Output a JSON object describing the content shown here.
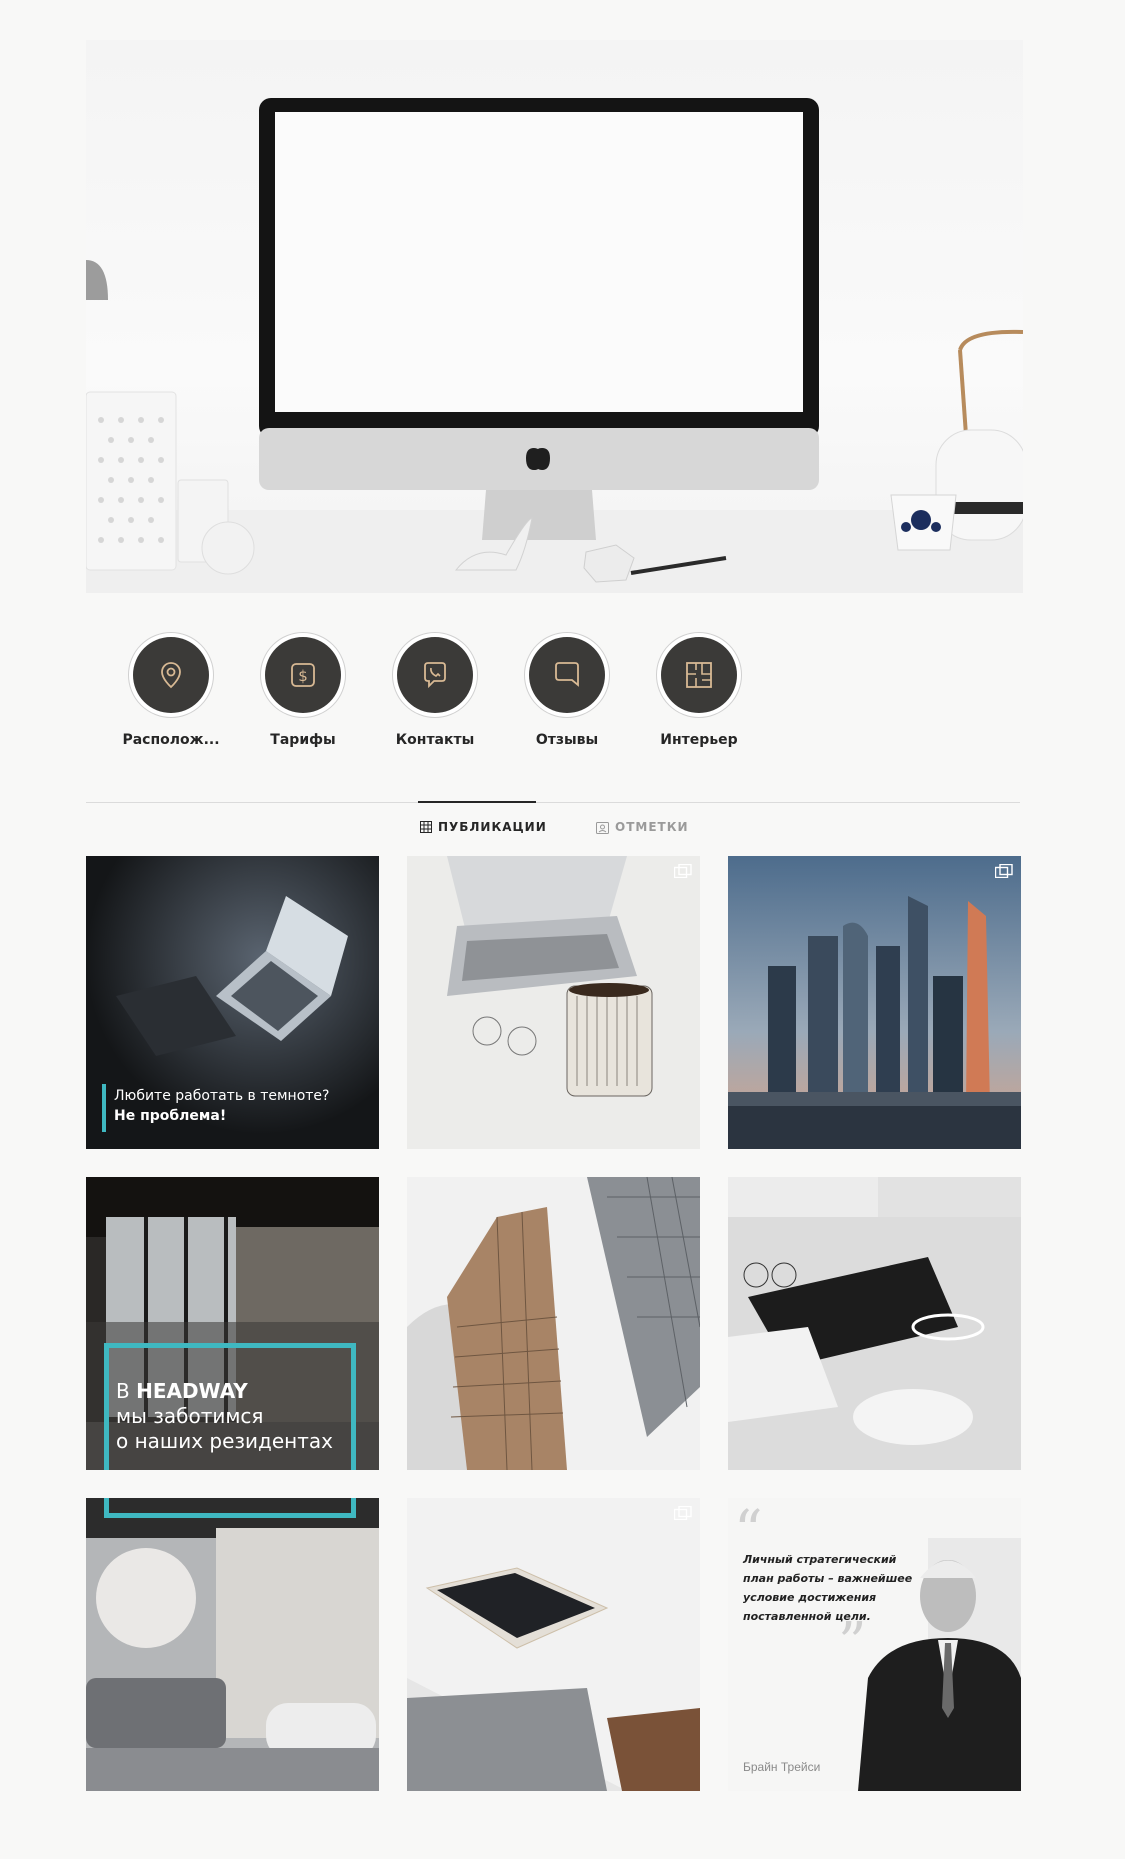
{
  "highlights": [
    {
      "label": "Располож...",
      "icon": "location-pin-icon"
    },
    {
      "label": "Тарифы",
      "icon": "dollar-sign-icon"
    },
    {
      "label": "Контакты",
      "icon": "phone-chat-icon"
    },
    {
      "label": "Отзывы",
      "icon": "speech-bubble-icon"
    },
    {
      "label": "Интерьер",
      "icon": "floor-plan-icon"
    }
  ],
  "tabs": {
    "publications": "ПУБЛИКАЦИИ",
    "tagged": "ОТМЕТКИ",
    "active": "publications"
  },
  "posts": {
    "p1": {
      "line1": "Любите работать в темноте?",
      "line2": "Не проблема!"
    },
    "p4": {
      "brand_prefix": "В ",
      "brand": "HEADWAY",
      "line2": "мы заботимся",
      "line3": "о наших резидентах"
    },
    "p9": {
      "quote_lines": [
        "Личный стратегический",
        "план работы – важнейшее",
        "условие достижения",
        "поставленной цели."
      ],
      "author": "Брайн Трейси"
    }
  },
  "colors": {
    "accent_teal": "#3fb8c1",
    "highlight_bg": "#3b3a38",
    "highlight_icon": "#d8b994"
  }
}
